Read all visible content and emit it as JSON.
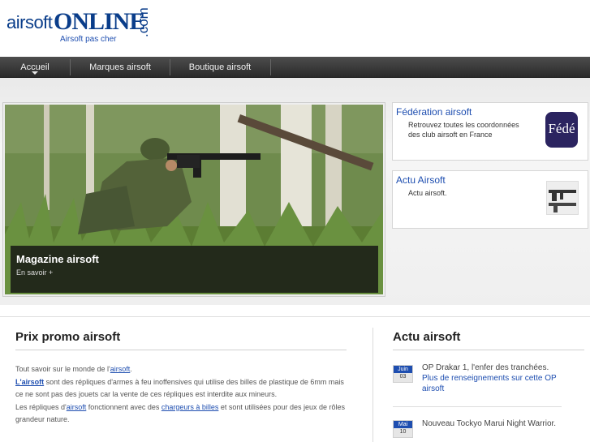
{
  "header": {
    "logo_part1": "airsoft",
    "logo_part2": "ONLINE",
    "logo_part3": ".com",
    "tagline": "Airsoft pas cher"
  },
  "nav": {
    "items": [
      "Accueil",
      "Marques airsoft",
      "Boutique airsoft"
    ]
  },
  "hero": {
    "caption_title": "Magazine airsoft",
    "caption_link": "En savoir +"
  },
  "side_boxes": [
    {
      "title": "Fédération airsoft",
      "text": "Retrouvez toutes les coordonnées des club airsoft en France",
      "badge": "Fédé"
    },
    {
      "title": "Actu Airsoft",
      "text": "Actu airsoft."
    }
  ],
  "left_section": {
    "title": "Prix promo airsoft",
    "p1_prefix": "Tout savoir sur le monde de l'",
    "p1_link": "airsoft",
    "p1_suffix": ".",
    "p2_link": "L'airsoft",
    "p2_text": " sont des répliques d'armes à feu inoffensives qui utilise des billes de plastique de 6mm mais ce ne sont pas des jouets car la vente de ces répliques est interdite aux mineurs.",
    "p3_prefix": "Les répliques d'",
    "p3_link1": "airsoft",
    "p3_mid": " fonctionnent avec des ",
    "p3_link2": "chargeurs à billes",
    "p3_suffix": " et sont utilisées pour des jeux de rôles grandeur nature."
  },
  "right_section": {
    "title": "Actu airsoft",
    "news": [
      {
        "month": "Juin",
        "day": "03",
        "title": "OP Drakar 1, l'enfer des tranchées.",
        "link": "Plus de renseignements sur cette OP airsoft"
      },
      {
        "month": "Mai",
        "day": "10",
        "title": "Nouveau Tockyo Marui Night Warrior."
      }
    ]
  },
  "colors": {
    "accent": "#1e4eb0",
    "nav_bg": "#333333"
  }
}
